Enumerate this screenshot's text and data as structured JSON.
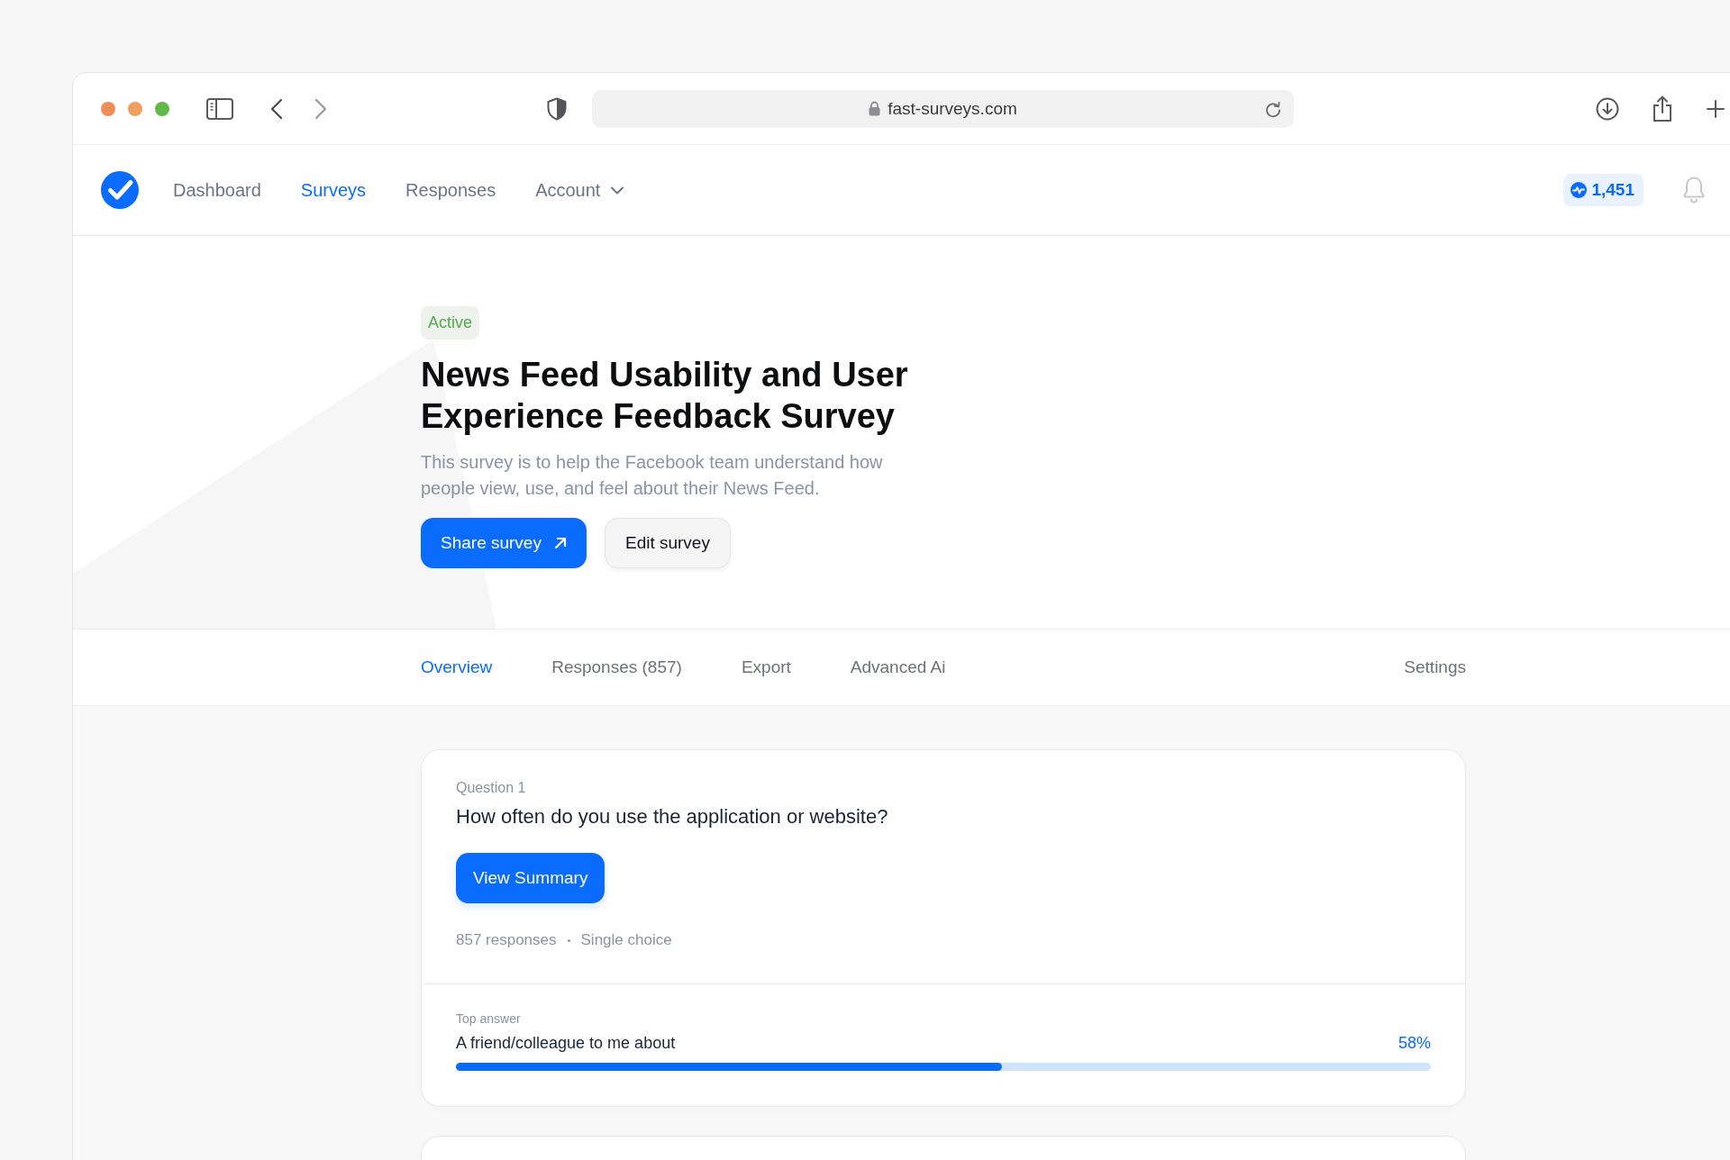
{
  "browser": {
    "url": "fast-surveys.com"
  },
  "navbar": {
    "items": [
      {
        "label": "Dashboard",
        "selected": false,
        "kind": "link"
      },
      {
        "label": "Surveys",
        "selected": true,
        "kind": "link"
      },
      {
        "label": "Responses",
        "selected": false,
        "kind": "link"
      },
      {
        "label": "Account",
        "selected": false,
        "kind": "dropdown"
      }
    ],
    "credits": "1,451"
  },
  "survey": {
    "status": "Active",
    "title": "News Feed Usability and User Experience Feedback Survey",
    "description": "This survey is to help the Facebook team understand how people view, use, and feel about their News Feed.",
    "actions": [
      {
        "label": "Share survey",
        "kind": "primary"
      },
      {
        "label": "Edit survey",
        "kind": "secondary"
      }
    ]
  },
  "tabs": [
    {
      "label": "Overview",
      "selected": true
    },
    {
      "label": "Responses (857)",
      "selected": false
    },
    {
      "label": "Export",
      "selected": false
    },
    {
      "label": "Advanced Ai",
      "selected": false
    }
  ],
  "tabs_right": [
    {
      "label": "Settings",
      "selected": false
    }
  ],
  "questions": [
    {
      "number": "Question 1",
      "text": "How often do you use the application or website?",
      "button": "View Summary",
      "responses": "857 responses",
      "type": "Single choice",
      "top_answer_label": "Top answer",
      "top_answer": "A friend/colleague to me about",
      "percent": "58%",
      "level": 0.56
    }
  ]
}
